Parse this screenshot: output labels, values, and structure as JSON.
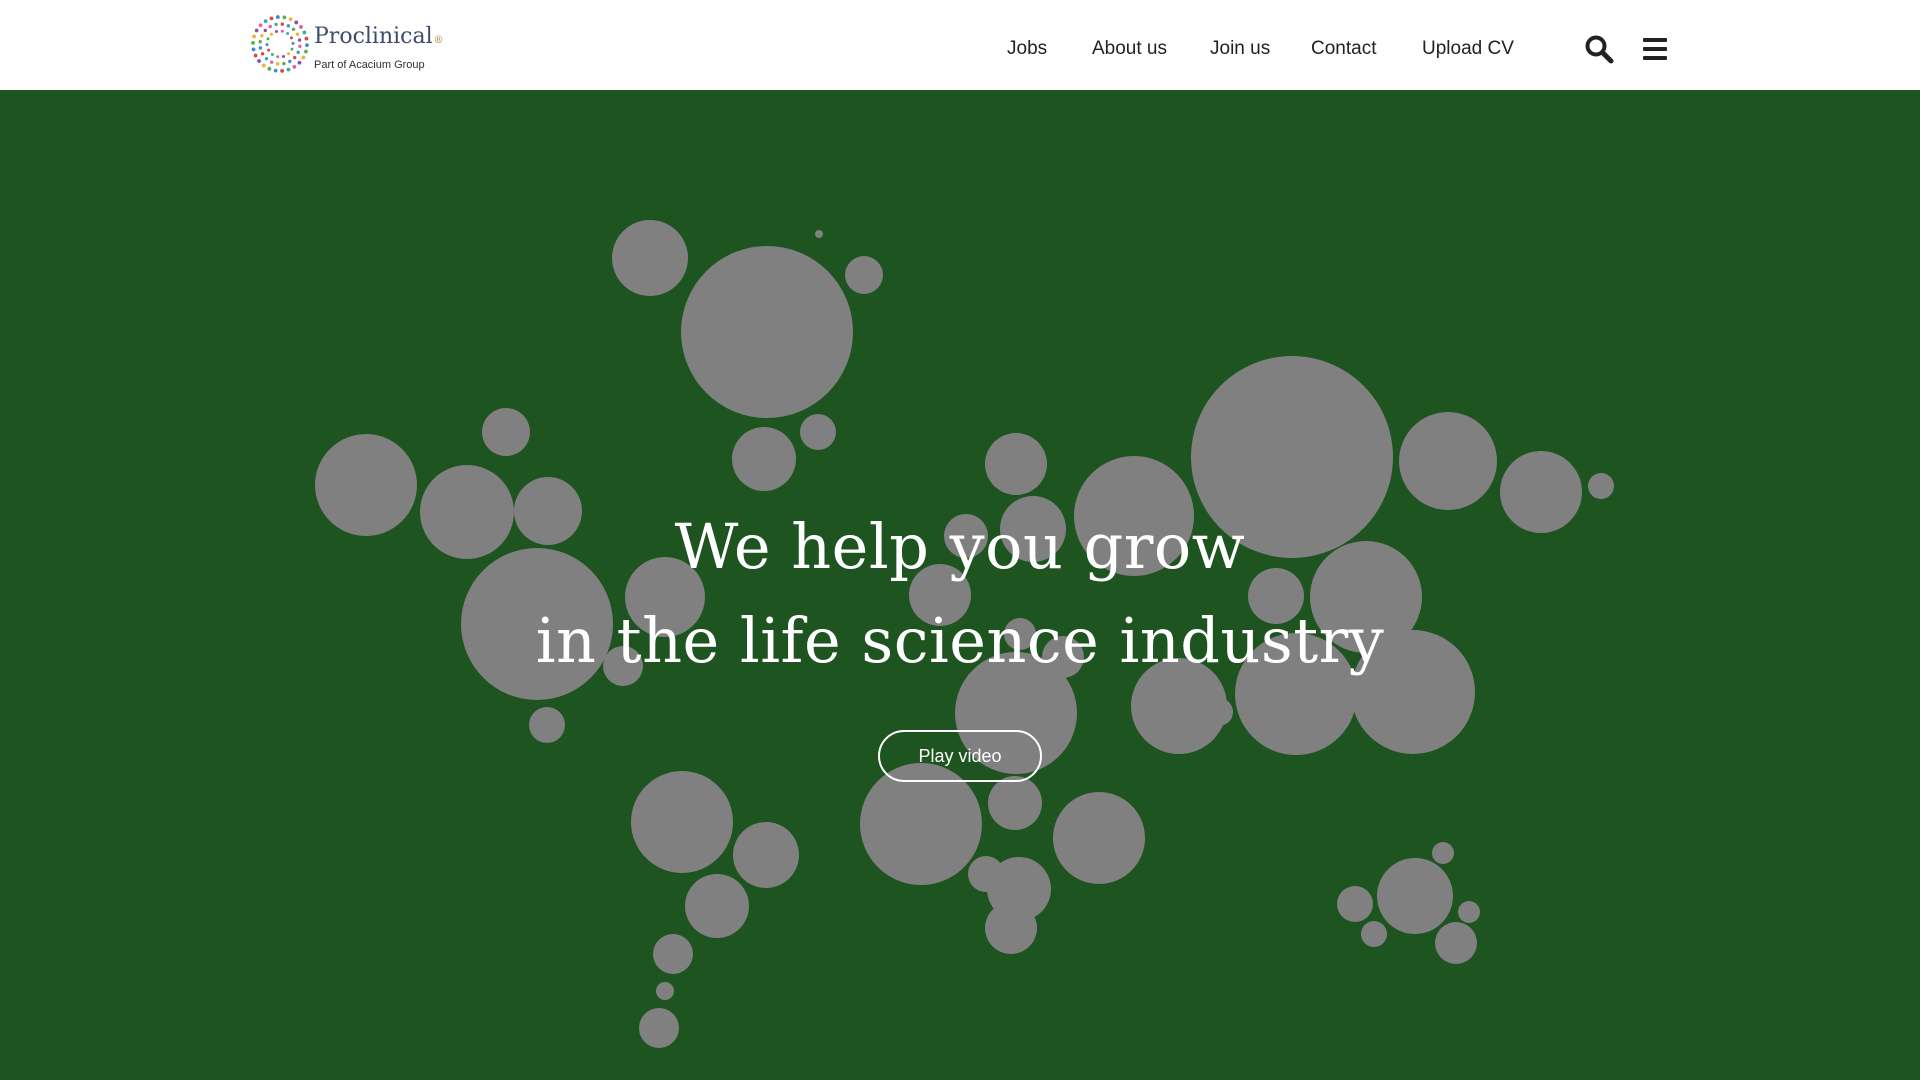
{
  "brand": {
    "name": "Proclinical",
    "registered_mark": "®",
    "tagline": "Part of Acacium Group"
  },
  "nav": {
    "items": [
      {
        "label": "Jobs"
      },
      {
        "label": "About us"
      },
      {
        "label": "Join us"
      },
      {
        "label": "Contact"
      },
      {
        "label": "Upload CV"
      }
    ],
    "search_icon": "search-icon",
    "menu_icon": "hamburger-menu-icon"
  },
  "hero": {
    "headline_line1": "We help you grow",
    "headline_line2": "in the life science industry",
    "play_video_label": "Play video",
    "background_color": "#1e5420",
    "bubble_color": "#808080"
  },
  "colors": {
    "header_bg": "#ffffff",
    "nav_text": "#222222",
    "logo_text": "#3d4b6e"
  }
}
